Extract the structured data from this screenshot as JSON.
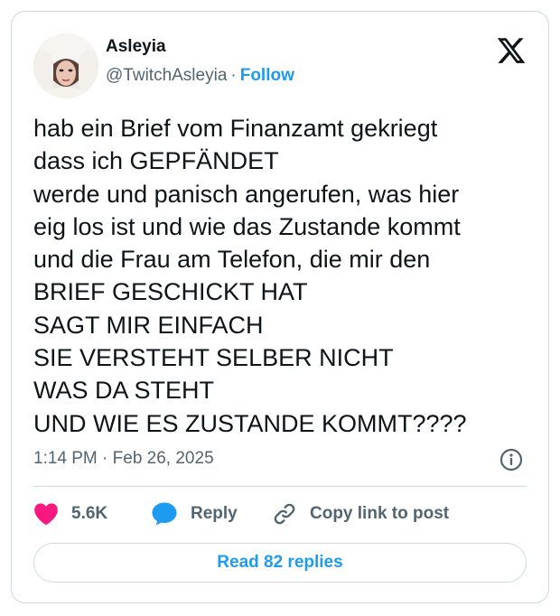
{
  "author": {
    "display_name": "Asleyia",
    "handle": "@TwitchAsleyia",
    "separator": "·",
    "follow_label": "Follow"
  },
  "tweet": {
    "lines": [
      "hab ein Brief vom Finanzamt gekriegt",
      "dass ich GEPFÄNDET",
      "werde und panisch angerufen, was hier",
      "eig los ist und wie das Zustande kommt",
      "und die Frau am Telefon, die mir den",
      "BRIEF GESCHICKT HAT",
      "SAGT MIR EINFACH",
      "SIE VERSTEHT SELBER NICHT",
      "WAS DA STEHT",
      "UND WIE ES ZUSTANDE KOMMT????"
    ],
    "time": "1:14 PM",
    "separator": "·",
    "date": "Feb 26, 2025"
  },
  "actions": {
    "like_count": "5.6K",
    "reply_label": "Reply",
    "copy_link_label": "Copy link to post"
  },
  "read_replies_label": "Read 82 replies",
  "colors": {
    "accent": "#1d9bf0",
    "like": "#f91880",
    "muted": "#536471",
    "border": "#cfd9de",
    "text": "#0f1419"
  },
  "icons": {
    "brand": "x-logo-icon",
    "like": "heart-icon",
    "reply": "speech-bubble-icon",
    "copy_link": "link-icon",
    "info": "info-icon"
  }
}
